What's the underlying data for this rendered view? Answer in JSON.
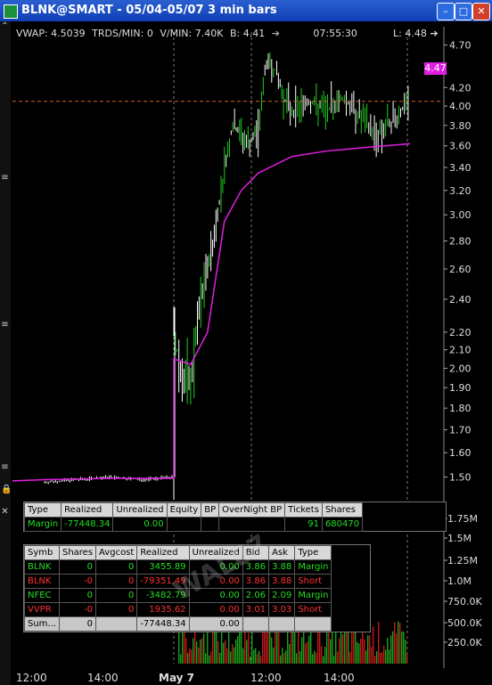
{
  "window": {
    "title": "BLNK@SMART - 05/04-05/07 3 min bars",
    "buttons": [
      "–",
      "□",
      "✕"
    ]
  },
  "legend": {
    "vwap": "VWAP: 4.5039",
    "trds": "TRDS/MIN: 0",
    "vmin": "V/MIN: 7.40K",
    "b": "B: 4.41",
    "time": "07:55:30",
    "last": "L: 4.48"
  },
  "price_tag": "4.47",
  "price_axis": [
    "4.70",
    "4.20",
    "4.00",
    "3.80",
    "3.60",
    "3.40",
    "3.20",
    "3.00",
    "2.80",
    "2.60",
    "2.40",
    "2.20",
    "2.10",
    "2.00",
    "1.90",
    "1.80",
    "1.70",
    "1.60",
    "1.50"
  ],
  "volume_axis": [
    "1.75M",
    "1.5M",
    "1.25M",
    "1.0M",
    "750.0K",
    "500.0K",
    "250.0K"
  ],
  "time_axis": [
    "12:00",
    "14:00",
    "May 7",
    "12:00",
    "14:00"
  ],
  "account": {
    "headers": [
      "Type",
      "Realized",
      "Unrealized",
      "Equity",
      "BP",
      "OverNight BP",
      "Tickets",
      "Shares"
    ],
    "row": [
      "Margin",
      "-77448.34",
      "0.00",
      "",
      "",
      "",
      "91",
      "680470"
    ]
  },
  "positions": {
    "headers": [
      "Symb",
      "Shares",
      "Avgcost",
      "Realized",
      "Unrealized",
      "Bid",
      "Ask",
      "Type"
    ],
    "rows": [
      [
        "BLNK",
        "0",
        "0",
        "3455.89",
        "0.00",
        "3.86",
        "3.88",
        "Margin"
      ],
      [
        "BLNK",
        "-0",
        "0",
        "-79351.49",
        "0.00",
        "3.86",
        "3.88",
        "Short"
      ],
      [
        "NFEC",
        "0",
        "0",
        "-3482.79",
        "0.00",
        "2.06",
        "2.09",
        "Margin"
      ],
      [
        "VVPR",
        "-0",
        "0",
        "1935.62",
        "0.00",
        "3.01",
        "3.03",
        "Short"
      ]
    ],
    "sum": [
      "Sum...",
      "0",
      "",
      "-77448.34",
      "0.00",
      "",
      "",
      ""
    ]
  },
  "watermark": "WAL87",
  "chart_data": {
    "type": "candlestick",
    "title": "BLNK@SMART - 05/04-05/07 3 min bars",
    "xlabel": "",
    "ylabel": "",
    "ylim": [
      1.45,
      4.75
    ],
    "price": [
      {
        "t": "05/04 12:00",
        "p": 1.48
      },
      {
        "t": "05/04 13:00",
        "p": 1.49
      },
      {
        "t": "05/04 14:00",
        "p": 1.5
      },
      {
        "t": "05/04 15:00",
        "p": 1.49
      },
      {
        "t": "05/04 16:00",
        "p": 1.5
      },
      {
        "t": "05/07 09:30",
        "p": 2.2
      },
      {
        "t": "05/07 09:45",
        "p": 1.95
      },
      {
        "t": "05/07 10:00",
        "p": 1.9
      },
      {
        "t": "05/07 10:15",
        "p": 2.3
      },
      {
        "t": "05/07 10:30",
        "p": 2.6
      },
      {
        "t": "05/07 10:45",
        "p": 2.9
      },
      {
        "t": "05/07 11:00",
        "p": 3.4
      },
      {
        "t": "05/07 11:15",
        "p": 3.8
      },
      {
        "t": "05/07 11:30",
        "p": 3.7
      },
      {
        "t": "05/07 11:45",
        "p": 3.6
      },
      {
        "t": "05/07 12:00",
        "p": 3.75
      },
      {
        "t": "05/07 12:15",
        "p": 4.5
      },
      {
        "t": "05/07 12:30",
        "p": 4.4
      },
      {
        "t": "05/07 12:45",
        "p": 4.1
      },
      {
        "t": "05/07 13:00",
        "p": 3.95
      },
      {
        "t": "05/07 13:30",
        "p": 4.05
      },
      {
        "t": "05/07 14:00",
        "p": 3.95
      },
      {
        "t": "05/07 14:30",
        "p": 4.1
      },
      {
        "t": "05/07 15:00",
        "p": 3.9
      },
      {
        "t": "05/07 15:30",
        "p": 3.7
      },
      {
        "t": "05/07 16:00",
        "p": 3.85
      },
      {
        "t": "05/07 16:30",
        "p": 4.05
      }
    ],
    "vwap_line": [
      {
        "t": "05/07 09:30",
        "p": 2.05
      },
      {
        "t": "05/07 10:00",
        "p": 2.02
      },
      {
        "t": "05/07 10:30",
        "p": 2.2
      },
      {
        "t": "05/07 11:00",
        "p": 2.95
      },
      {
        "t": "05/07 11:30",
        "p": 3.2
      },
      {
        "t": "05/07 12:00",
        "p": 3.35
      },
      {
        "t": "05/07 13:00",
        "p": 3.5
      },
      {
        "t": "05/07 14:00",
        "p": 3.55
      },
      {
        "t": "05/07 15:00",
        "p": 3.58
      },
      {
        "t": "05/07 16:30",
        "p": 3.62
      }
    ],
    "reference_line": 4.05,
    "last": 4.48
  },
  "colors": {
    "bars": "#ffffff",
    "green_bars": "#22cc22",
    "vwap": "#e020e0",
    "reference": "#c86432",
    "volume_up": "#1aa01a",
    "volume_down": "#c01818",
    "titlebar": "#1f4fc4"
  }
}
